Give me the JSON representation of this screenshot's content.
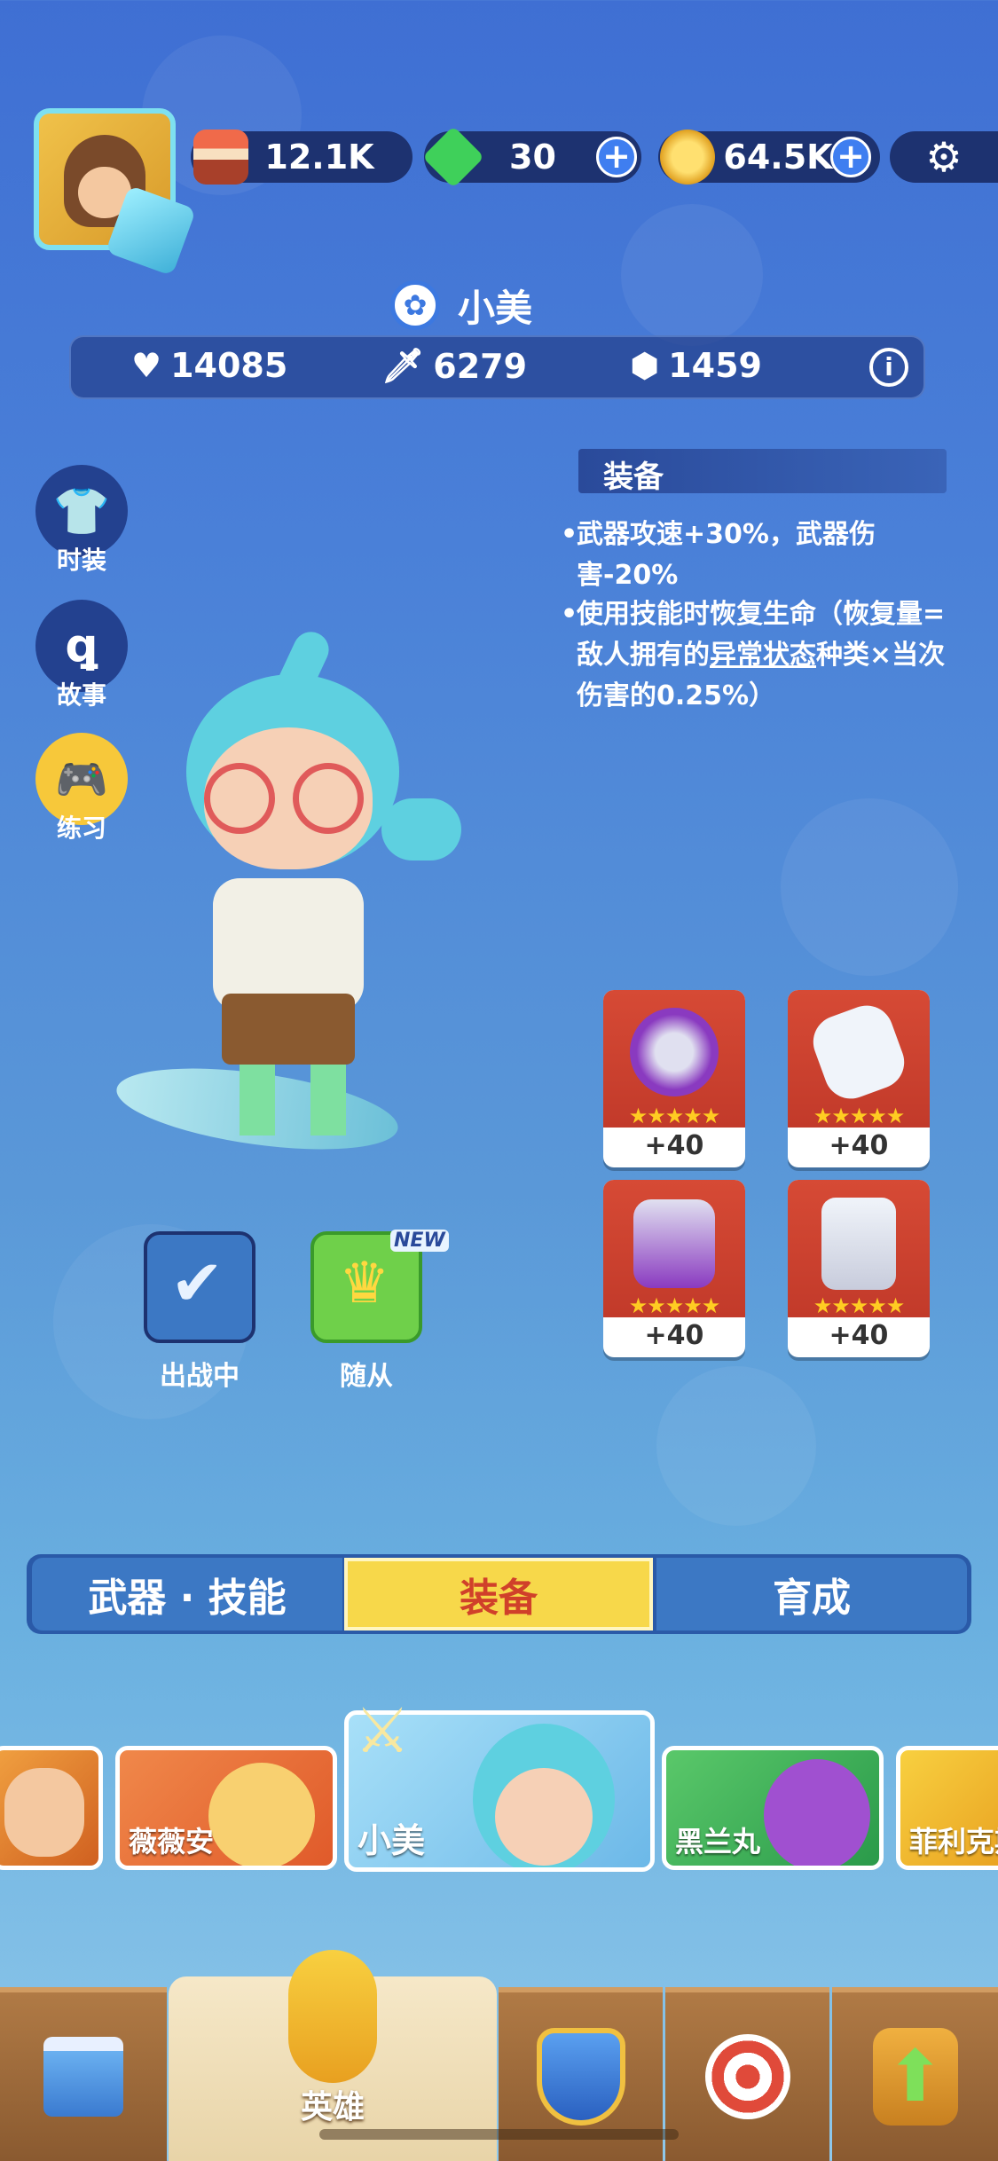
{
  "resources": {
    "cake": {
      "value": "12.1K",
      "icon": "cake-icon"
    },
    "gem": {
      "value": "30",
      "icon": "gem-icon"
    },
    "coin": {
      "value": "64.5K",
      "icon": "coin-icon"
    }
  },
  "hero": {
    "name": "小美",
    "stats": {
      "health": "14085",
      "attack": "6279",
      "defense": "1459"
    }
  },
  "side_menu": [
    {
      "label": "时装",
      "icon": "shirt-icon"
    },
    {
      "label": "故事",
      "icon": "story-icon"
    },
    {
      "label": "练习",
      "icon": "gamepad-icon"
    }
  ],
  "equipment": {
    "title": "装备",
    "bullet1": "武器攻速+30%，武器伤害-20%",
    "bullet2_part1": "使用技能时恢复生命（恢复量=敌人拥有的",
    "bullet2_link": "异常状态",
    "bullet2_part2": "种类×当次伤害的0.25%）",
    "items": [
      {
        "level": "+40",
        "stars": "★★★★★"
      },
      {
        "level": "+40",
        "stars": "★★★★★"
      },
      {
        "level": "+40",
        "stars": "★★★★★"
      },
      {
        "level": "+40",
        "stars": "★★★★★"
      }
    ]
  },
  "actions": {
    "deploy_label": "出战中",
    "follower_label": "随从",
    "new_badge": "NEW"
  },
  "tabs": [
    {
      "label": "武器 · 技能",
      "active": false
    },
    {
      "label": "装备",
      "active": true
    },
    {
      "label": "育成",
      "active": false
    }
  ],
  "heroes": [
    {
      "name": ""
    },
    {
      "name": "薇薇安"
    },
    {
      "name": "小美"
    },
    {
      "name": "黑兰丸"
    },
    {
      "name": "菲利克斯"
    }
  ],
  "bottom_nav": {
    "hero_label": "英雄"
  },
  "colors": {
    "tab_active": "#f7d84a",
    "tab_inactive": "#3c78c4",
    "panel_dark": "#1d3270"
  }
}
